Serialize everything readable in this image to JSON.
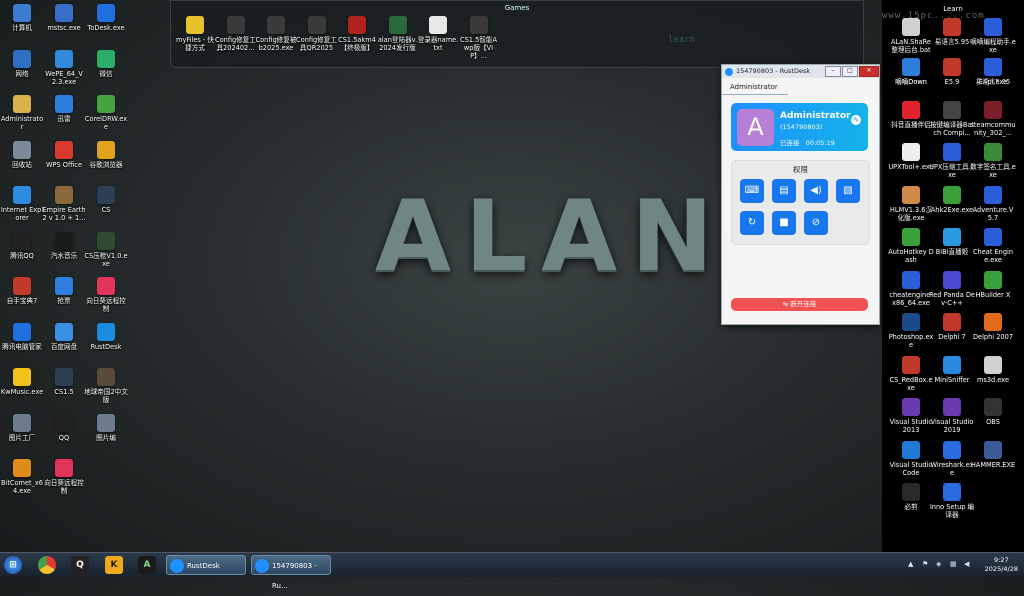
{
  "background": {
    "wallpaper_text": "ALAN",
    "learn_text": "learn"
  },
  "fences": {
    "games": {
      "title": "Games"
    },
    "learn": {
      "title": "Learn",
      "watermark": "www.15pc.....com"
    }
  },
  "left_icons": [
    {
      "label": "计算机",
      "icon": "computer-icon",
      "color": "#3b7bd1"
    },
    {
      "label": "mstsc.exe",
      "icon": "remote-desktop-icon",
      "color": "#3a6fc9"
    },
    {
      "label": "ToDesk.exe",
      "icon": "todesk-icon",
      "color": "#1f6fe0"
    },
    {
      "label": "网络",
      "icon": "network-icon",
      "color": "#2d6fc0"
    },
    {
      "label": "WePE_64_V2.3.exe",
      "icon": "wepe-icon",
      "color": "#2e8bd9"
    },
    {
      "label": "微信",
      "icon": "wechat-icon",
      "color": "#2aae67"
    },
    {
      "label": "Administrator",
      "icon": "user-folder-icon",
      "color": "#d9b24a"
    },
    {
      "label": "迅雷",
      "icon": "thunder-icon",
      "color": "#2b7ed9"
    },
    {
      "label": "CorelDRW.exe",
      "icon": "coreldraw-icon",
      "color": "#46a43e"
    },
    {
      "label": "回收站",
      "icon": "recycle-bin-icon",
      "color": "#7a8a99"
    },
    {
      "label": "WPS Office",
      "icon": "wps-icon",
      "color": "#d93a2f"
    },
    {
      "label": "谷歌浏览器",
      "icon": "chrome-icon",
      "color": "#e0a21a"
    },
    {
      "label": "Internet Explorer",
      "icon": "ie-icon",
      "color": "#2b8be0"
    },
    {
      "label": "Empire Earth 2 v 1.0 + 1...",
      "icon": "empire-earth-icon",
      "color": "#8a6a3a"
    },
    {
      "label": "CS",
      "icon": "cs-icon",
      "color": "#2c3f55"
    },
    {
      "label": "腾讯QQ",
      "icon": "qq-icon",
      "color": "#222"
    },
    {
      "label": "汽水音乐",
      "icon": "music-icon",
      "color": "#1a1a1a"
    },
    {
      "label": "CS压枪V1.0.exe",
      "icon": "cs-tool-icon",
      "color": "#2f4a2f"
    },
    {
      "label": "自手宝典7",
      "icon": "book-icon",
      "color": "#c0392b"
    },
    {
      "label": "抢票",
      "icon": "ticket-icon",
      "color": "#2f7de0"
    },
    {
      "label": "向日葵远程控制",
      "icon": "sunflower-icon",
      "color": "#e2335a"
    },
    {
      "label": "腾讯电脑管家",
      "icon": "pc-manager-icon",
      "color": "#1f6fe0"
    },
    {
      "label": "百度网盘",
      "icon": "baidu-pan-icon",
      "color": "#3a8ee6"
    },
    {
      "label": "RustDesk",
      "icon": "rustdesk-icon",
      "color": "#1a8cde"
    },
    {
      "label": "KwMusic.exe",
      "icon": "kwmusic-icon",
      "color": "#f2c21b"
    },
    {
      "label": "CS1.5",
      "icon": "cs15-icon",
      "color": "#2c3f55"
    },
    {
      "label": "地球帝国2中文版",
      "icon": "earth-empire-icon",
      "color": "#5a4a3a"
    },
    {
      "label": "图片工厂",
      "icon": "picture-factory-icon",
      "color": "#6b7b8c"
    },
    {
      "label": "QQ",
      "icon": "qq-penguin-icon",
      "color": "#222"
    },
    {
      "label": "图片编",
      "icon": "picture-edit-icon",
      "color": "#6b7b8c"
    },
    {
      "label": "BitComet_x64.exe",
      "icon": "bitcomet-icon",
      "color": "#e08a1a"
    },
    {
      "label": "向日葵远程控制",
      "icon": "sunflower-icon-2",
      "color": "#e2335a"
    }
  ],
  "games_icons": [
    {
      "label": "myFiles - 快捷方式",
      "icon": "star-icon",
      "color": "#e6c229"
    },
    {
      "label": "Config修复工具202402...",
      "icon": "alan-config-icon",
      "color": "#3a3a3a"
    },
    {
      "label": "Config修复被b2025.exe",
      "icon": "alan-config-icon-2",
      "color": "#3a3a3a"
    },
    {
      "label": "Config修复工具QR2025",
      "icon": "alan-config-icon-3",
      "color": "#3a3a3a"
    },
    {
      "label": "CS1.5akm4【终极版】",
      "icon": "cs-akm4-icon",
      "color": "#b0221c"
    },
    {
      "label": "alan登陆器v.2024发行版",
      "icon": "alan-login-icon",
      "color": "#2a6a3a"
    },
    {
      "label": "登录器name.txt",
      "icon": "text-file-icon",
      "color": "#e8e8e8"
    },
    {
      "label": "CS1.5智能Awp版【VIP】...",
      "icon": "alan-awp-icon",
      "color": "#3a3a3a"
    }
  ],
  "right_icons": [
    {
      "label": "嘀嘀Down",
      "icon": "download-icon",
      "color": "#2b7ed9"
    },
    {
      "label": "易语言5.95",
      "icon": "eyuyan-icon",
      "color": "#c0392b"
    },
    {
      "label": "易语言5.95",
      "icon": "eyuyan-icon-2",
      "color": "#c0392b"
    },
    {
      "label": "嘀嘀编程助手.exe",
      "icon": "coding-helper-icon",
      "color": "#2b5fd9"
    },
    {
      "label": "ALaN.ShaRe整理后台.bat",
      "icon": "bat-file-icon",
      "color": "#d0d0d0"
    },
    {
      "label": "嘀嘀Down",
      "icon": "down-icon",
      "color": "#2b7ed9"
    },
    {
      "label": "E5.9",
      "icon": "e59-icon",
      "color": "#c0392b"
    },
    {
      "label": "EApi.exe",
      "icon": "eapi-icon",
      "color": "#2b5fd9"
    },
    {
      "label": "抖音直播伴侣",
      "icon": "douyin-icon",
      "color": "#e0232f"
    },
    {
      "label": "按键编译器Batch Compi...",
      "icon": "batch-compiler-icon",
      "color": "#444"
    },
    {
      "label": "steamcommunity_302_...",
      "icon": "steam-icon",
      "color": "#7a1f2a"
    },
    {
      "label": "UPXTool+.exe",
      "icon": "upxtool-icon",
      "color": "#eee"
    },
    {
      "label": "UPX压缩工具.exe",
      "icon": "upx-icon",
      "color": "#2b5fd9"
    },
    {
      "label": "数字签名工具.exe",
      "icon": "signature-icon",
      "color": "#3a8a3a"
    },
    {
      "label": "HLMV1.3.6汉化版.exe",
      "icon": "hlmv-icon",
      "color": "#d08a4a"
    },
    {
      "label": "Ahk2Exe.exe",
      "icon": "ahk-icon",
      "color": "#3aa03a"
    },
    {
      "label": "Adventure.V5.7",
      "icon": "adventure-icon",
      "color": "#2b5fd9"
    },
    {
      "label": "AutoHotkey Dash",
      "icon": "autohotkey-icon",
      "color": "#3aa03a"
    },
    {
      "label": "BiBi直播姬",
      "icon": "bibi-icon",
      "color": "#2a9ae0"
    },
    {
      "label": "Cheat Engine.exe",
      "icon": "cheat-engine-icon",
      "color": "#2b5fd9"
    },
    {
      "label": "cheatengine-x86_64.exe",
      "icon": "cheat-engine-x64-icon",
      "color": "#2b5fd9"
    },
    {
      "label": "Red Panda Dev-C++",
      "icon": "devcpp-icon",
      "color": "#4a4ad0"
    },
    {
      "label": "HBuilder X",
      "icon": "hbuilder-icon",
      "color": "#3aa03a"
    },
    {
      "label": "Photoshop.exe",
      "icon": "photoshop-icon",
      "color": "#1a4a8a"
    },
    {
      "label": "Delphi 7",
      "icon": "delphi7-icon",
      "color": "#c0392b"
    },
    {
      "label": "Delphi 2007",
      "icon": "delphi2007-icon",
      "color": "#e06a1a"
    },
    {
      "label": "CS_RedBox.exe",
      "icon": "redbox-icon",
      "color": "#c0392b"
    },
    {
      "label": "MiniSniffer",
      "icon": "minisniffer-icon",
      "color": "#2a8ae0"
    },
    {
      "label": "ms3d.exe",
      "icon": "ms3d-icon",
      "color": "#d0d0d0"
    },
    {
      "label": "Visual Studio 2013",
      "icon": "vs2013-icon",
      "color": "#6a3ab0"
    },
    {
      "label": "Visual Studio 2019",
      "icon": "vs2019-icon",
      "color": "#6a3ab0"
    },
    {
      "label": "OBS",
      "icon": "obs-icon",
      "color": "#333"
    },
    {
      "label": "Visual Studio Code",
      "icon": "vscode-icon",
      "color": "#1f7ad6"
    },
    {
      "label": "Wireshark.exe",
      "icon": "wireshark-icon",
      "color": "#2a6ae0"
    },
    {
      "label": "HAMMER.EXE",
      "icon": "hammer-icon",
      "color": "#3a5a9a"
    },
    {
      "label": "必剪",
      "icon": "bijian-icon",
      "color": "#2a2a2a"
    },
    {
      "label": "Inno Setup 编译器",
      "icon": "inno-setup-icon",
      "color": "#2a6ae0"
    }
  ],
  "rustdesk": {
    "window_title": "154790803 - RustDesk",
    "tab": "Administrator",
    "avatar_letter": "A",
    "user_name": "Administrator",
    "user_id": "(154790803)",
    "status_label": "已连接",
    "elapsed": "00:05:19",
    "permissions_title": "权限",
    "permissions": [
      "keyboard-icon",
      "clipboard-icon",
      "audio-icon",
      "file-icon",
      "restart-icon",
      "recording-icon",
      "block-input-icon"
    ],
    "disconnect_label": "断开连接",
    "accent": "#1e90ff",
    "danger": "#f05252"
  },
  "taskbar": {
    "tasks": [
      {
        "label": "RustDesk",
        "icon": "rustdesk-icon"
      },
      {
        "label": "154790803 - Ru...",
        "icon": "rustdesk-icon"
      }
    ],
    "time": "9:27",
    "date": "2025/4/28"
  }
}
